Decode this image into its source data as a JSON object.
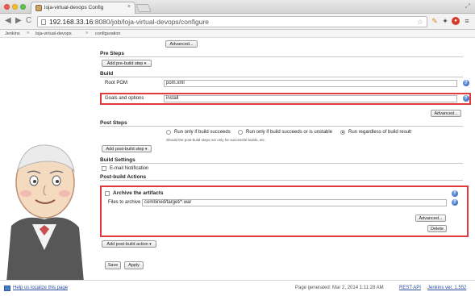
{
  "browser": {
    "tab_title": "loja-virtual-devops Config",
    "tab_close": "×",
    "url_host": "192.168.33.16",
    "url_rest": ":8080/job/loja-virtual-devops/configure",
    "nav_back": "◀",
    "nav_forward": "▶",
    "nav_reload": "C",
    "extensions": [
      "key-icon",
      "wrench-icon",
      "record-icon",
      "menu-icon"
    ],
    "ext_labels": [
      "✎",
      "✦",
      "●",
      "≡"
    ]
  },
  "breadcrumbs": [
    "Jenkins",
    "loja-virtual-devops",
    "configuration"
  ],
  "breadcrumb_sep": "»",
  "form": {
    "top_advanced_label": "Advanced...",
    "pre_steps": {
      "title": "Pre Steps",
      "add_button": "Add pre-build step"
    },
    "build": {
      "title": "Build",
      "root_pom_label": "Root POM",
      "root_pom_value": "pom.xml",
      "goals_label": "Goals and options",
      "goals_value": "install",
      "advanced_label": "Advanced..."
    },
    "post_steps": {
      "title": "Post Steps",
      "options": [
        {
          "label": "Run only if build succeeds",
          "selected": false
        },
        {
          "label": "Run only if build succeeds or is unstable",
          "selected": false
        },
        {
          "label": "Run regardless of build result",
          "selected": true
        }
      ],
      "note": "Should the post-build steps run only for successful builds, etc.",
      "add_button": "Add post-build step"
    },
    "build_settings": {
      "title": "Build Settings",
      "email_label": "E-mail Notification"
    },
    "post_build_actions": {
      "title": "Post-build Actions",
      "archive_title": "Archive the artifacts",
      "files_label": "Files to archive",
      "files_value": "combined/target/*.war",
      "advanced_label": "Advanced...",
      "delete_label": "Delete",
      "add_button": "Add post-build action"
    },
    "save_label": "Save",
    "apply_label": "Apply"
  },
  "footer": {
    "localize_link": "Help us localize this page",
    "generated": "Page generated: Mar 2, 2014 1:11:28 AM",
    "rest_api": "REST API",
    "version": "Jenkins ver. 1.552"
  },
  "colors": {
    "highlight": "#e03a3a",
    "help_icon": "#2b5fb8",
    "link": "#2a4f9e"
  }
}
